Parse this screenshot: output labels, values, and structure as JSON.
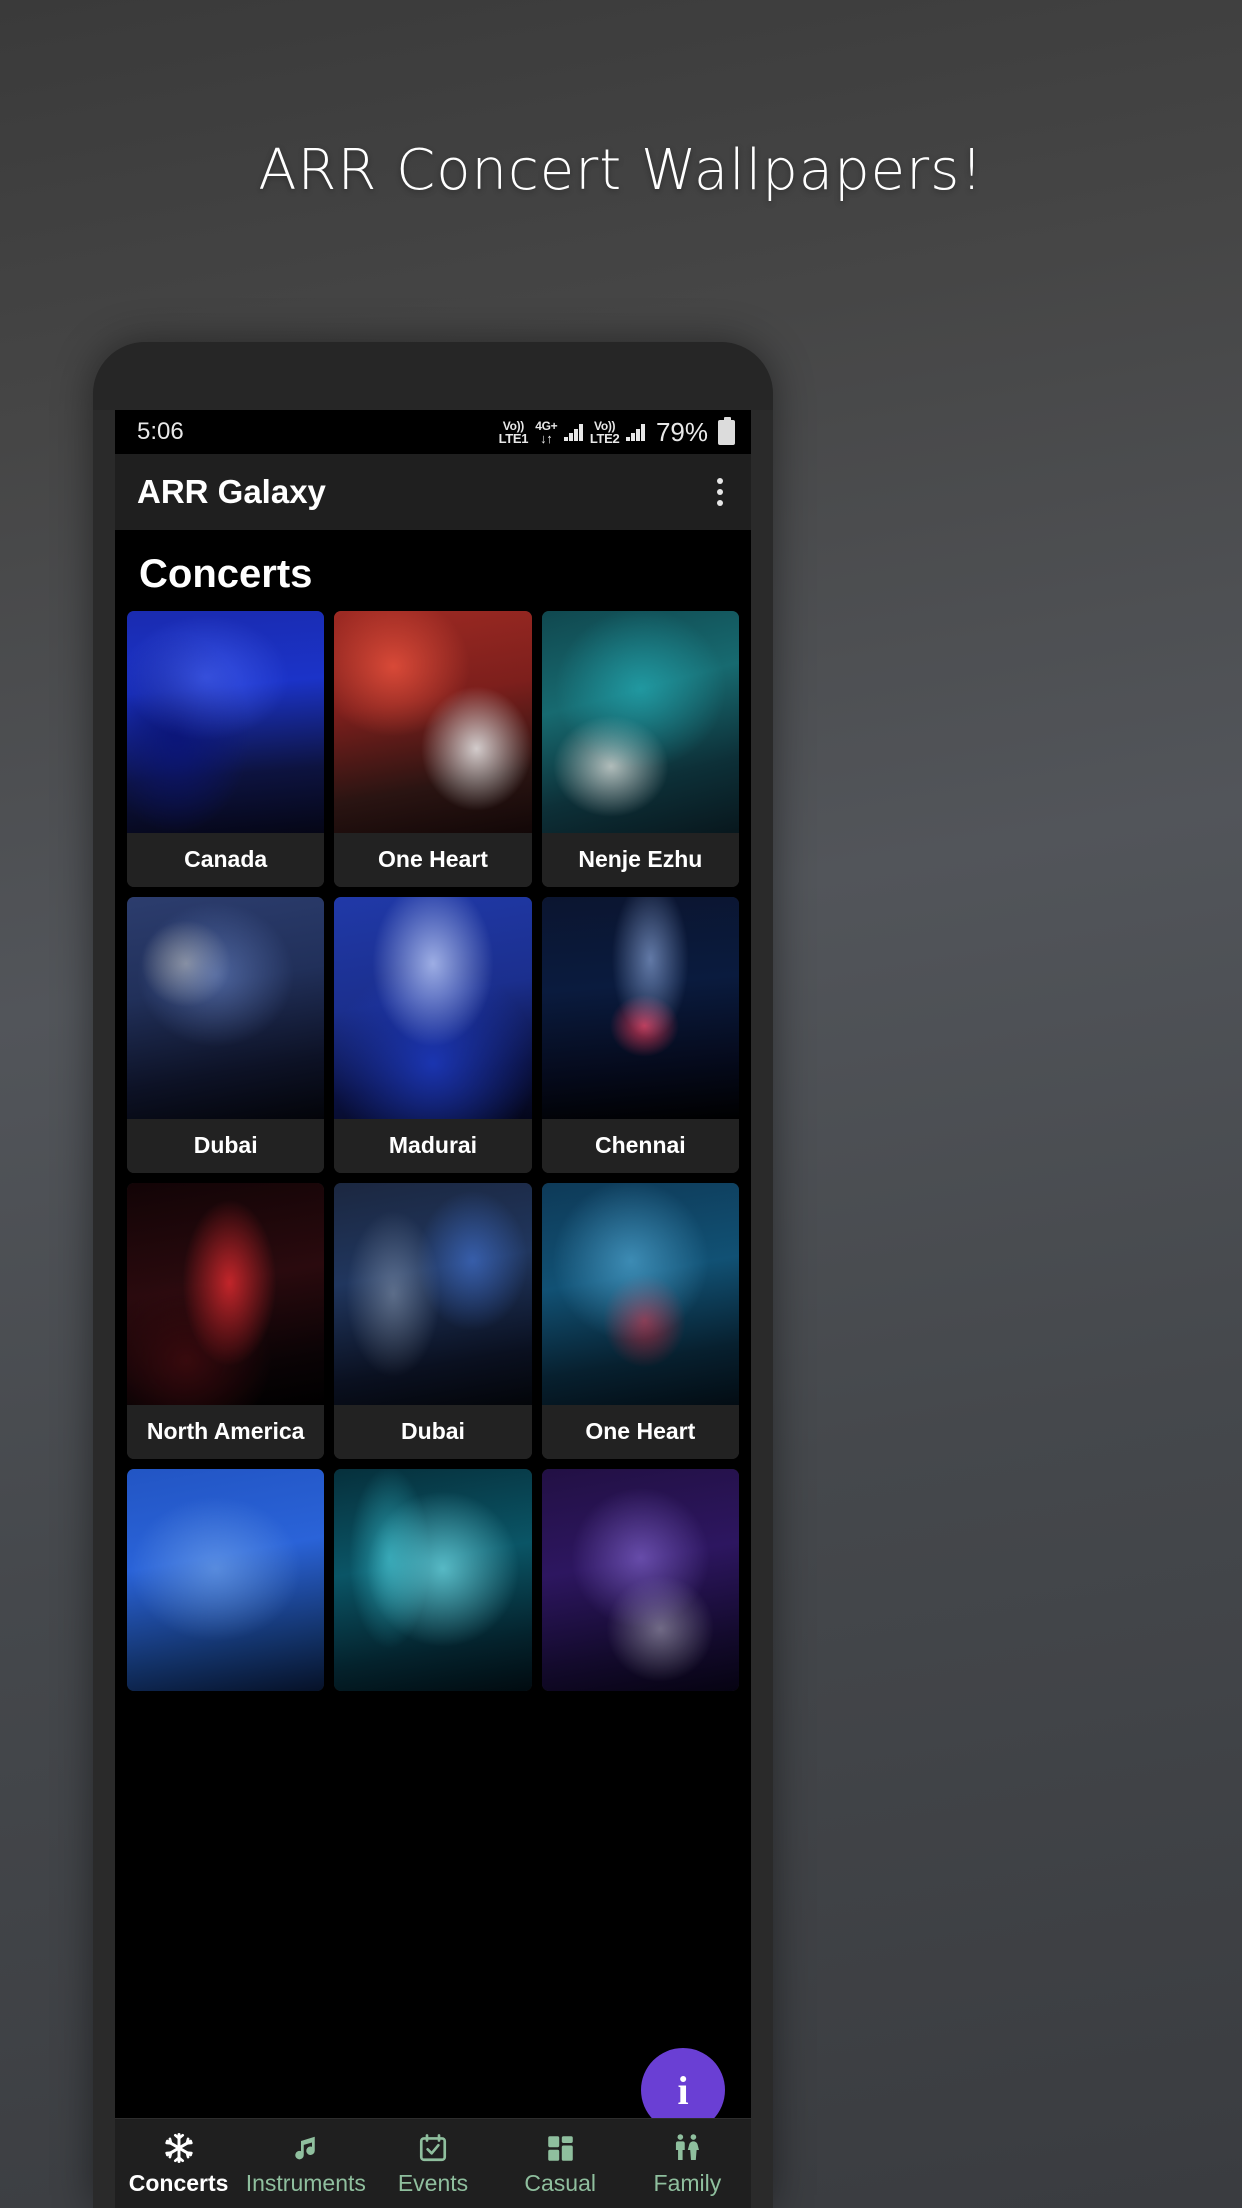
{
  "promo": {
    "title": "ARR Concert Wallpapers!"
  },
  "status_bar": {
    "time": "5:06",
    "sim1_top": "Vo))",
    "sim1_bottom": "LTE1",
    "network_top": "4G+",
    "network_bottom": "↓↑",
    "sim2_top": "Vo))",
    "sim2_bottom": "LTE2",
    "battery_percent": "79%"
  },
  "app_bar": {
    "title": "ARR Galaxy",
    "overflow_label": "More options"
  },
  "content": {
    "section_title": "Concerts",
    "tiles": [
      {
        "label": "Canada",
        "photo": "ph1"
      },
      {
        "label": "One Heart",
        "photo": "ph2"
      },
      {
        "label": "Nenje Ezhu",
        "photo": "ph3"
      },
      {
        "label": "Dubai",
        "photo": "ph4"
      },
      {
        "label": "Madurai",
        "photo": "ph5"
      },
      {
        "label": "Chennai",
        "photo": "ph6"
      },
      {
        "label": "North America",
        "photo": "ph7"
      },
      {
        "label": "Dubai",
        "photo": "ph8"
      },
      {
        "label": "One Heart",
        "photo": "ph9"
      },
      {
        "label": "",
        "photo": "ph10"
      },
      {
        "label": "",
        "photo": "ph11"
      },
      {
        "label": "",
        "photo": "ph12"
      }
    ]
  },
  "fab": {
    "icon": "info-icon",
    "glyph": "i",
    "color": "#6a3fd4"
  },
  "bottom_nav": {
    "active_color": "#ffffff",
    "inactive_color": "#8fbf9e",
    "items": [
      {
        "label": "Concerts",
        "icon": "snowflake-icon",
        "active": true
      },
      {
        "label": "Instruments",
        "icon": "music-note-icon",
        "active": false
      },
      {
        "label": "Events",
        "icon": "calendar-check-icon",
        "active": false
      },
      {
        "label": "Casual",
        "icon": "dashboard-icon",
        "active": false
      },
      {
        "label": "Family",
        "icon": "family-icon",
        "active": false
      }
    ]
  }
}
